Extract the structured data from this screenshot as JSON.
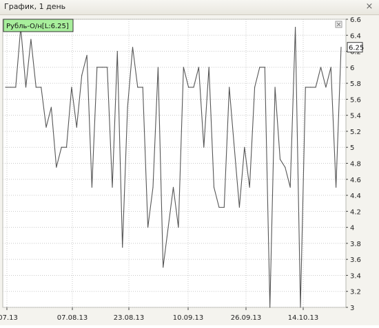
{
  "window": {
    "title": "График, 1 день",
    "close_glyph": "×"
  },
  "legend": {
    "text": "Рубль-О/н[L:6.25]",
    "color": "#a8ef9c"
  },
  "last_value_label": "6.25",
  "colors": {
    "line": "#555555",
    "grid": "#c8c8c8",
    "plot_bg": "#f4f3ee"
  },
  "chart_data": {
    "type": "line",
    "title": "",
    "xlabel": "",
    "ylabel": "",
    "ylim": [
      3,
      6.6
    ],
    "y_ticks": [
      3,
      3.2,
      3.4,
      3.6,
      3.8,
      4,
      4.2,
      4.4,
      4.6,
      4.8,
      5,
      5.2,
      5.4,
      5.6,
      5.8,
      6,
      6.2,
      6.4,
      6.6
    ],
    "y_tick_labels": [
      "3",
      "3.2",
      "3.4",
      "3.6",
      "3.8",
      "4",
      "4.2",
      "4.4",
      "4.6",
      "4.8",
      "5",
      "5.2",
      "5.4",
      "5.6",
      "5.8",
      "6",
      "6.2",
      "6.4",
      "6.6"
    ],
    "x_tick_labels": [
      ".07.13",
      "07.08.13",
      "23.08.13",
      "10.09.13",
      "26.09.13",
      "14.10.13"
    ],
    "grid": true,
    "legend_position": "top-left",
    "series": [
      {
        "name": "Рубль-О/н",
        "values": [
          5.75,
          5.75,
          5.75,
          6.5,
          5.75,
          6.35,
          5.75,
          5.75,
          5.25,
          5.5,
          4.75,
          5.0,
          5.0,
          5.75,
          5.25,
          5.9,
          6.15,
          4.5,
          6.0,
          6.0,
          6.0,
          4.5,
          6.2,
          3.75,
          5.5,
          6.25,
          5.75,
          5.75,
          4.0,
          4.5,
          6.0,
          3.5,
          4.0,
          4.5,
          4.0,
          6.0,
          5.75,
          5.75,
          6.0,
          5.0,
          6.0,
          4.5,
          4.25,
          4.25,
          5.75,
          5.0,
          4.25,
          5.0,
          4.5,
          5.75,
          6.0,
          6.0,
          3.0,
          5.75,
          4.85,
          4.75,
          4.5,
          6.5,
          3.0,
          5.75,
          5.75,
          5.75,
          6.0,
          5.75,
          6.0,
          4.5,
          6.25
        ]
      }
    ]
  }
}
